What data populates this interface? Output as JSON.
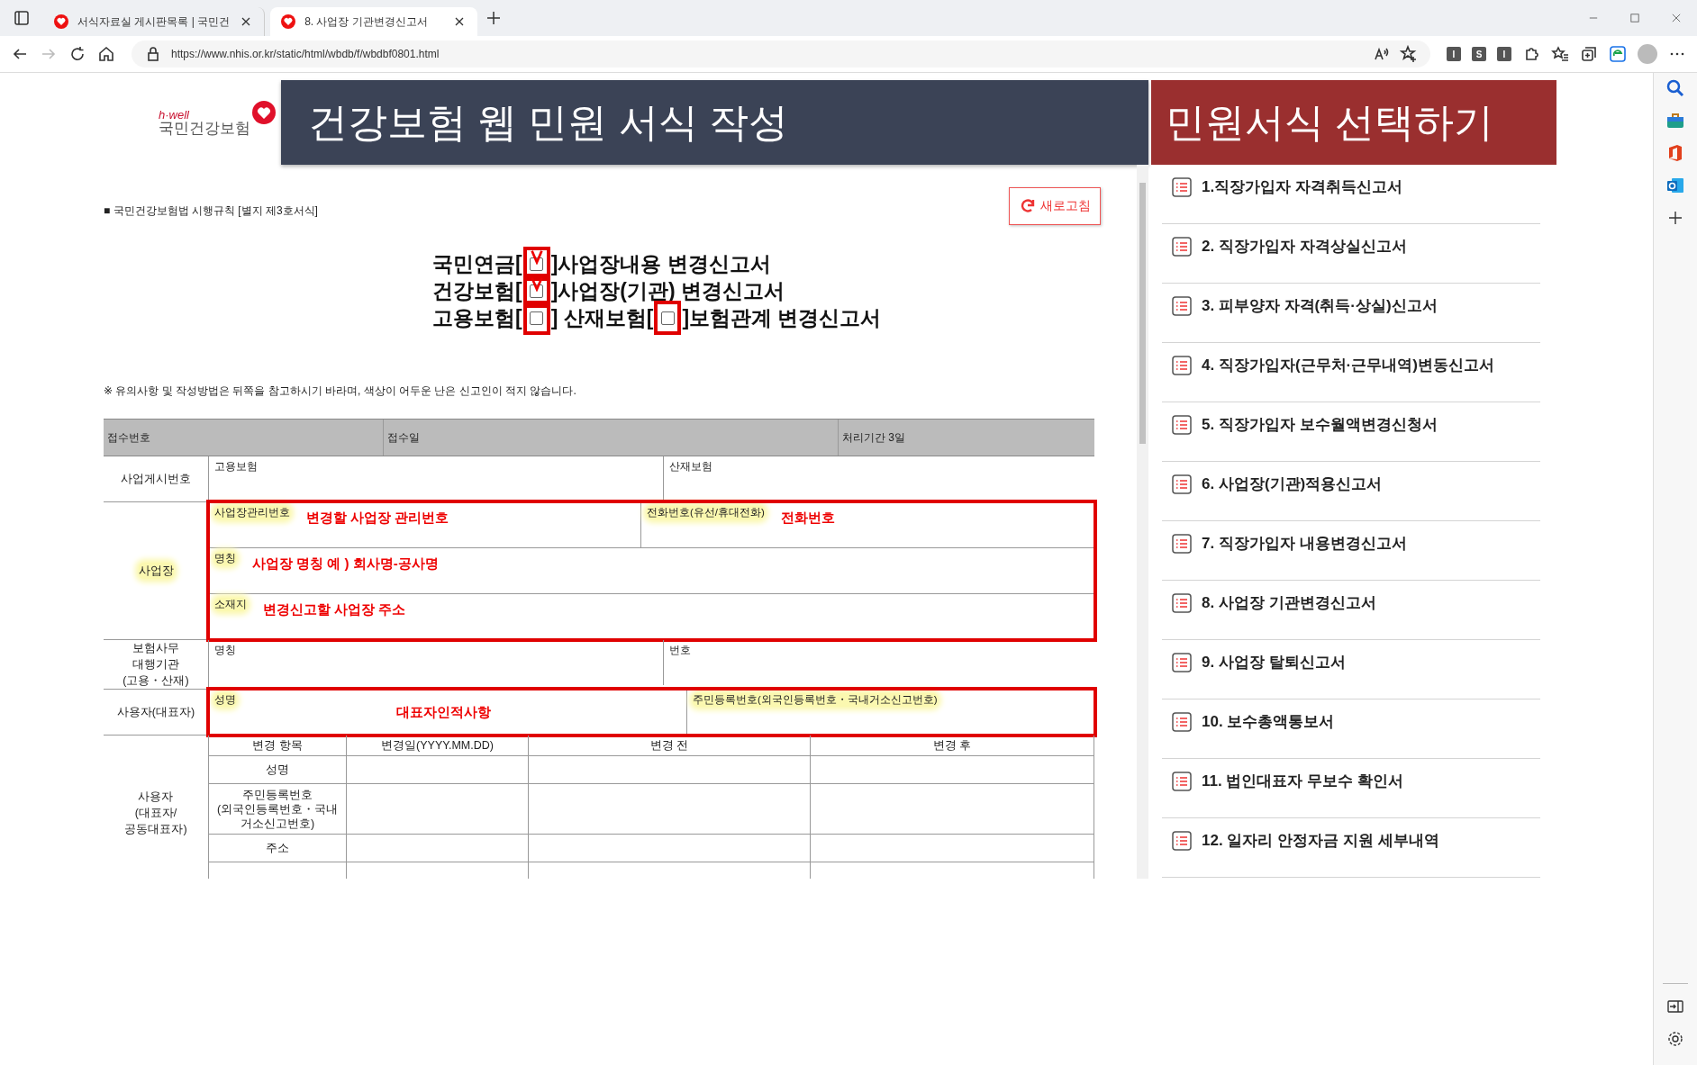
{
  "browser": {
    "tabs": [
      {
        "title": "서식자료실 게시판목록 | 국민건",
        "selected": false
      },
      {
        "title": "8. 사업장 기관변경신고서",
        "selected": true
      }
    ],
    "url": "https://www.nhis.or.kr/static/html/wbdb/f/wbdbf0801.html",
    "extensions": [
      "I",
      "S",
      "I"
    ]
  },
  "logo": {
    "tagline": "h·well",
    "name": "국민건강보험"
  },
  "header": {
    "title": "건강보험 웹 민원 서식 작성"
  },
  "form": {
    "regulation": "■ 국민건강보험법 시행규칙 [별지 제3호서식]",
    "refresh_button": "새로고침",
    "title_lines": [
      {
        "parts": [
          {
            "kind": "text",
            "text": "국민연금["
          },
          {
            "kind": "checkbox",
            "checked": true,
            "annotated": true
          },
          {
            "kind": "text",
            "text": "]사업장내용 변경신고서"
          }
        ]
      },
      {
        "parts": [
          {
            "kind": "text",
            "text": "건강보험["
          },
          {
            "kind": "checkbox",
            "checked": true,
            "annotated": true
          },
          {
            "kind": "text",
            "text": "]사업장(기관) 변경신고서"
          }
        ]
      },
      {
        "parts": [
          {
            "kind": "text",
            "text": "고용보험["
          },
          {
            "kind": "checkbox",
            "checked": false,
            "annotated": true
          },
          {
            "kind": "text",
            "text": "] 산재보험["
          },
          {
            "kind": "checkbox",
            "checked": false,
            "annotated": true
          },
          {
            "kind": "text",
            "text": "]보험관계 변경신고서"
          }
        ]
      }
    ],
    "note": "※ 유의사항 및 작성방법은 뒤쪽을 참고하시기 바라며, 색상이 어두운 난은 신고인이 적지 않습니다.",
    "receipt_row": [
      "접수번호",
      "접수일",
      "처리기간  3일"
    ],
    "sections": [
      {
        "label": "사업게시번호",
        "highlighted": false,
        "annotated": false,
        "rows": [
          [
            {
              "label": "고용보험",
              "highlighted": false
            },
            {
              "label": "산재보험",
              "highlighted": false
            }
          ]
        ]
      },
      {
        "label": "사업장",
        "highlighted": true,
        "annotated": true,
        "rows": [
          [
            {
              "label": "사업장관리번호",
              "highlighted": true,
              "note": "변경할 사업장 관리번호"
            },
            {
              "label": "전화번호(유선/휴대전화)",
              "highlighted": true,
              "note": "전화번호"
            }
          ],
          [
            {
              "label": "명칭",
              "highlighted": true,
              "note": "사업장 명칭 예 ) 회사명-공사명"
            }
          ],
          [
            {
              "label": "소재지",
              "highlighted": true,
              "note": "변경신고할 사업장 주소"
            }
          ]
        ]
      },
      {
        "label": "보험사무\n대행기관\n(고용・산재)",
        "highlighted": false,
        "annotated": false,
        "rows": [
          [
            {
              "label": "명칭",
              "highlighted": false
            },
            {
              "label": "번호",
              "highlighted": false
            }
          ]
        ]
      },
      {
        "label": "사용자(대표자)",
        "highlighted": false,
        "annotated": true,
        "rows": [
          [
            {
              "label": "성명",
              "highlighted": true,
              "note": "대표자인적사항"
            },
            {
              "label": "주민등록번호(외국인등록번호・국내거소신고번호)",
              "highlighted": true
            }
          ]
        ]
      }
    ],
    "change_table": {
      "label": "사용자\n(대표자/\n공동대표자)",
      "columns": [
        "변경 항목",
        "변경일(YYYY.MM.DD)",
        "변경 전",
        "변경 후"
      ],
      "rows": [
        "성명",
        "주민등록번호\n(외국인등록번호・국내\n거소신고번호)",
        "주소"
      ]
    }
  },
  "side_panel": {
    "title": "민원서식 선택하기",
    "items": [
      {
        "label": "1.직장가입자 자격취득신고서"
      },
      {
        "label": "2. 직장가입자 자격상실신고서"
      },
      {
        "label": "3. 피부양자 자격(취득·상실)신고서"
      },
      {
        "label": "4. 직장가입자(근무처·근무내역)변동신고서"
      },
      {
        "label": "5. 직장가입자 보수월액변경신청서"
      },
      {
        "label": "6. 사업장(기관)적용신고서"
      },
      {
        "label": "7. 직장가입자 내용변경신고서"
      },
      {
        "label": "8. 사업장 기관변경신고서"
      },
      {
        "label": "9. 사업장 탈퇴신고서"
      },
      {
        "label": "10. 보수총액통보서"
      },
      {
        "label": "11. 법인대표자 무보수 확인서"
      },
      {
        "label": "12. 일자리 안정자금 지원 세부내역"
      }
    ]
  }
}
